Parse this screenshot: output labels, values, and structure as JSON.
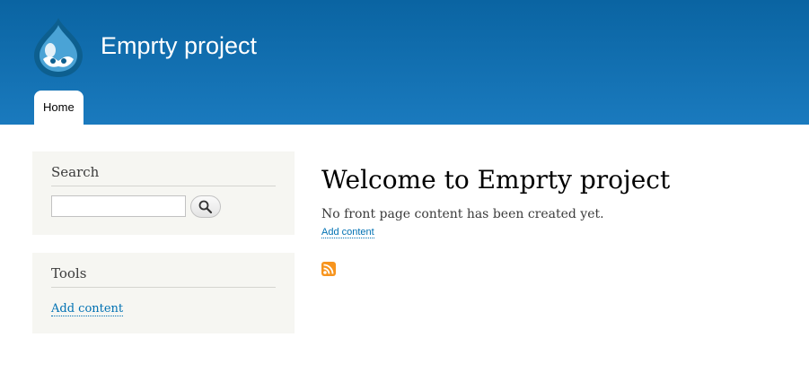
{
  "header": {
    "site_name": "Emprty project",
    "menu": [
      {
        "label": "Home"
      }
    ]
  },
  "sidebar": {
    "search": {
      "title": "Search",
      "input_value": ""
    },
    "tools": {
      "title": "Tools",
      "link_label": "Add content"
    }
  },
  "main": {
    "title": "Welcome to Emprty project",
    "message": "No front page content has been created yet.",
    "link_label": "Add content"
  },
  "colors": {
    "header_top": "#0a64a2",
    "header_bottom": "#1a7abe",
    "link": "#0071b3",
    "sidebar_bg": "#f6f6f2",
    "feed": "#f7941d"
  }
}
